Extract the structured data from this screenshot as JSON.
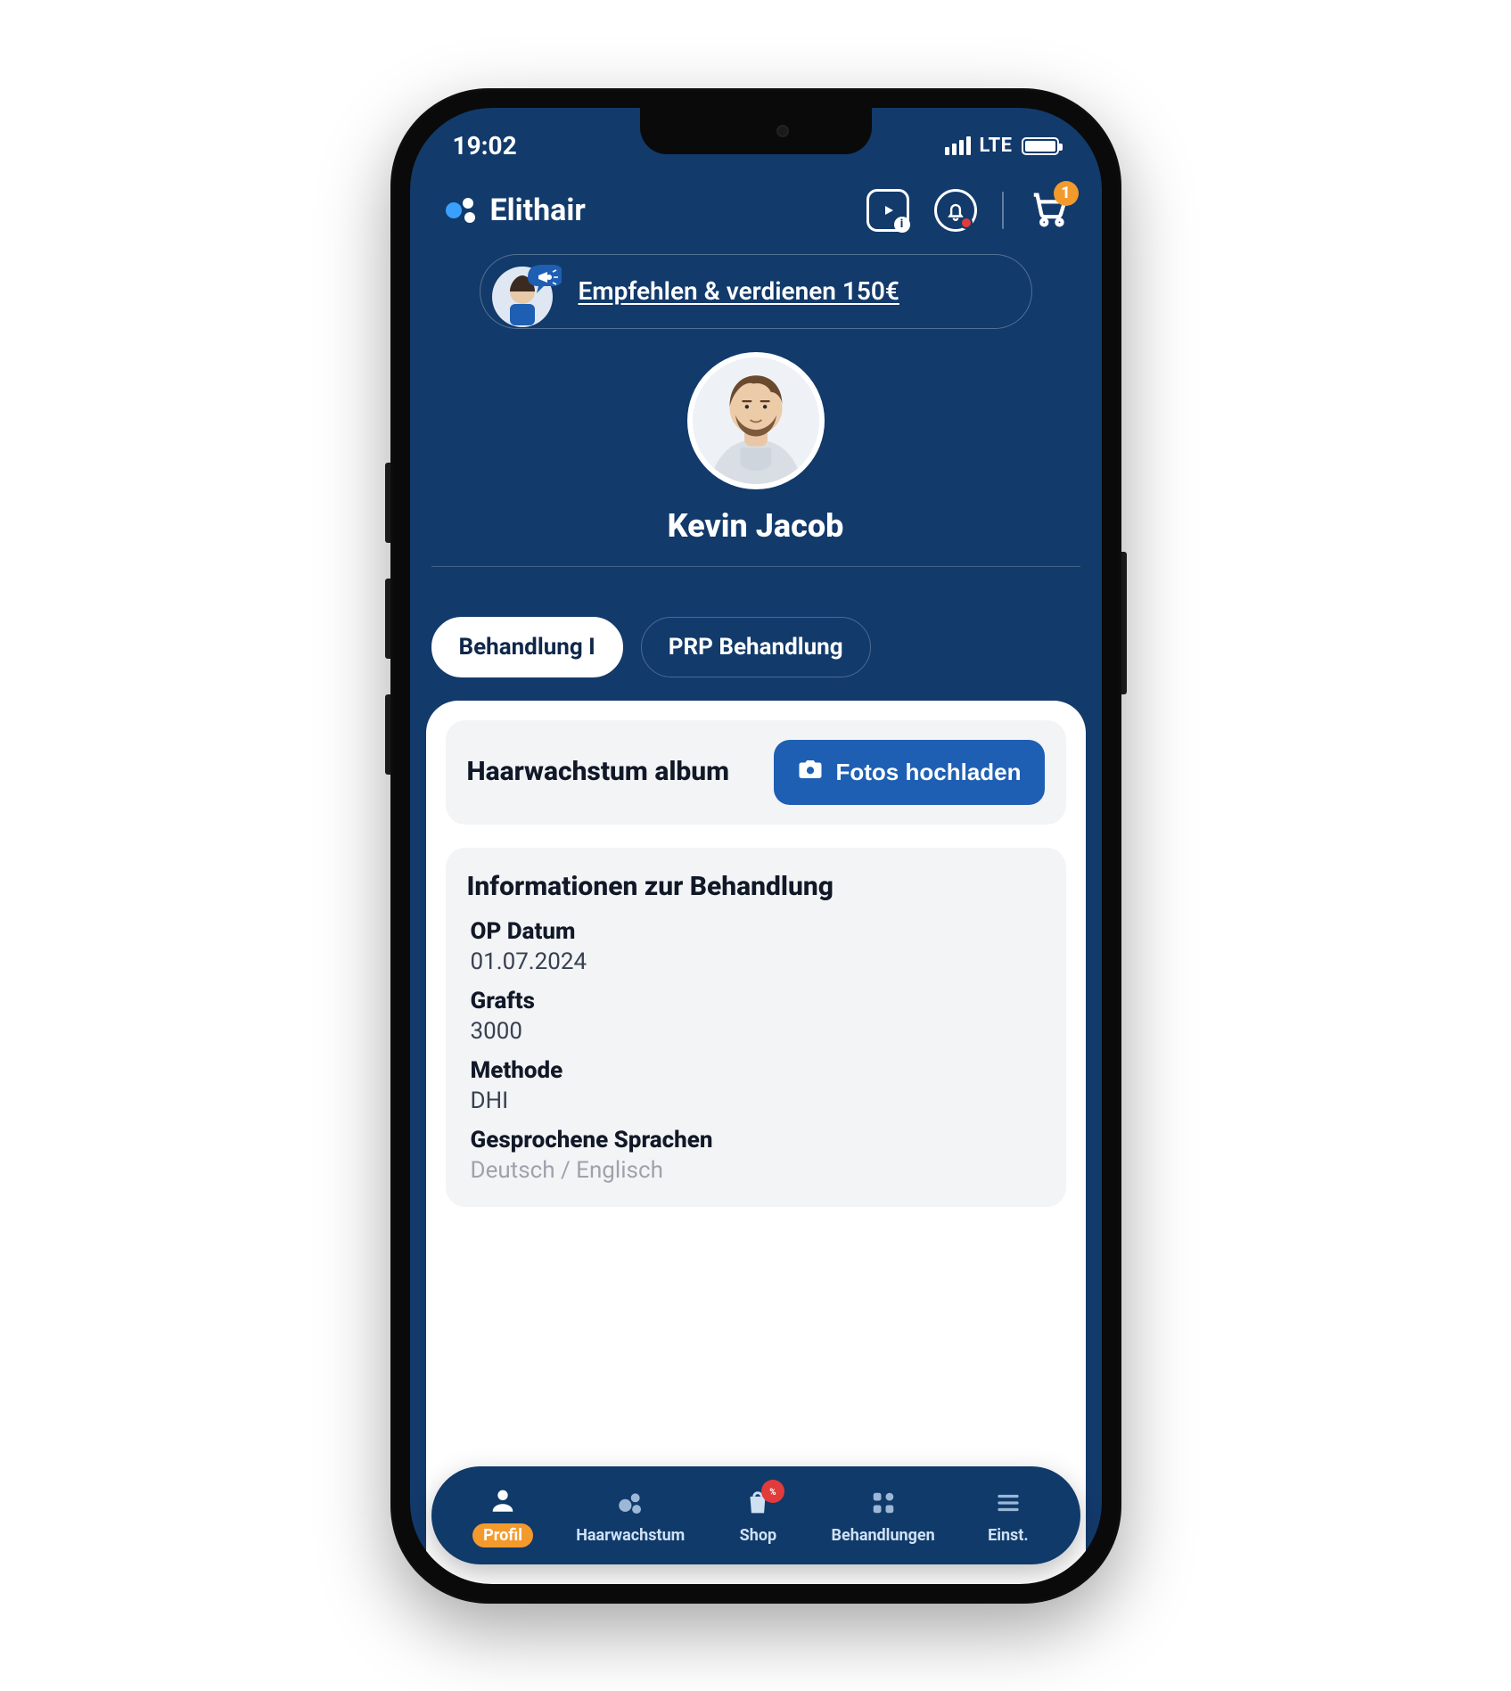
{
  "status": {
    "time": "19:02",
    "network": "LTE"
  },
  "header": {
    "brand": "Elithair",
    "cart_count": "1"
  },
  "referral": {
    "text": "Empfehlen & verdienen 150€"
  },
  "profile": {
    "name": "Kevin Jacob"
  },
  "tabs": [
    {
      "label": "Behandlung I",
      "active": true
    },
    {
      "label": "PRP Behandlung",
      "active": false
    }
  ],
  "album": {
    "title": "Haarwachstum album",
    "button": "Fotos hochladen"
  },
  "treatment_info": {
    "heading": "Informationen zur Behandlung",
    "items": [
      {
        "label": "OP Datum",
        "value": "01.07.2024"
      },
      {
        "label": "Grafts",
        "value": "3000"
      },
      {
        "label": "Methode",
        "value": "DHI"
      },
      {
        "label": "Gesprochene Sprachen",
        "value": "Deutsch / Englisch"
      }
    ]
  },
  "bottom_nav": [
    {
      "label": "Profil"
    },
    {
      "label": "Haarwachstum"
    },
    {
      "label": "Shop"
    },
    {
      "label": "Behandlungen"
    },
    {
      "label": "Einst."
    }
  ]
}
